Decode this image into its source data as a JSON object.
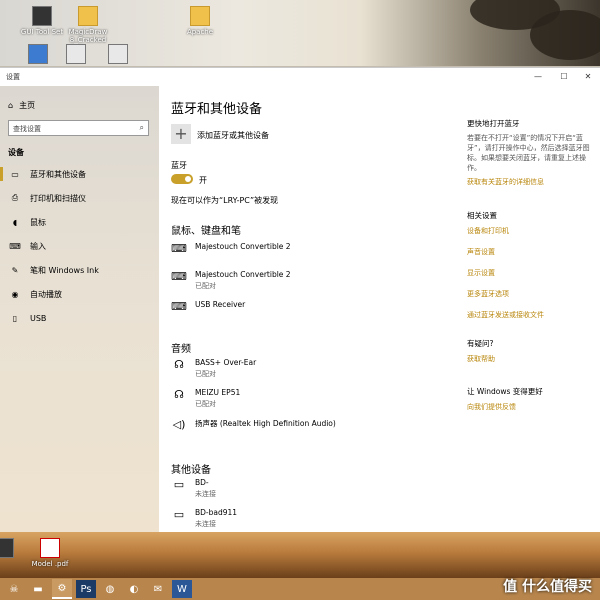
{
  "desktop": {
    "icons": [
      {
        "label": "GUI Tool Set",
        "icon": "app-icon"
      },
      {
        "label": "MagicDraw 8_Cracked",
        "icon": "folder-icon"
      },
      {
        "label": "Apache",
        "icon": "folder-icon"
      },
      {
        "label": "Model .pdf",
        "icon": "pdf-icon"
      }
    ]
  },
  "taskbar": {
    "apps": [
      "alienware-icon",
      "file-explorer-icon",
      "settings-icon",
      "photoshop-icon",
      "chrome-icon",
      "uplay-icon",
      "email-icon",
      "word-icon"
    ]
  },
  "watermark": "值 什么值得买",
  "window": {
    "title": "设置",
    "controls": {
      "minimize": "—",
      "maximize": "☐",
      "close": "✕"
    }
  },
  "sidebar": {
    "home": "主页",
    "search_placeholder": "查找设置",
    "section": "设备",
    "items": [
      {
        "label": "蓝牙和其他设备",
        "icon": "bluetooth-icon",
        "active": true
      },
      {
        "label": "打印机和扫描仪",
        "icon": "printer-icon",
        "active": false
      },
      {
        "label": "鼠标",
        "icon": "mouse-icon",
        "active": false
      },
      {
        "label": "输入",
        "icon": "keyboard-icon",
        "active": false
      },
      {
        "label": "笔和 Windows Ink",
        "icon": "pen-icon",
        "active": false
      },
      {
        "label": "自动播放",
        "icon": "autoplay-icon",
        "active": false
      },
      {
        "label": "USB",
        "icon": "usb-icon",
        "active": false
      }
    ]
  },
  "main": {
    "title": "蓝牙和其他设备",
    "add_device": "添加蓝牙或其他设备",
    "bluetooth_label": "蓝牙",
    "bluetooth_state": "开",
    "discoverable": "现在可以作为“LRY-PC”被发现",
    "sections": {
      "mouse_keyboard_pen": {
        "title": "鼠标、键盘和笔",
        "devices": [
          {
            "name": "Majestouch Convertible 2",
            "status": ""
          },
          {
            "name": "Majestouch Convertible 2",
            "status": "已配对"
          },
          {
            "name": "USB Receiver",
            "status": ""
          }
        ]
      },
      "audio": {
        "title": "音频",
        "devices": [
          {
            "name": "BASS+ Over-Ear",
            "status": "已配对"
          },
          {
            "name": "MEIZU EP51",
            "status": "已配对"
          },
          {
            "name": "扬声器 (Realtek High Definition Audio)",
            "status": ""
          }
        ]
      },
      "other": {
        "title": "其他设备",
        "devices": [
          {
            "name": "BD-",
            "status": "未连接"
          },
          {
            "name": "BD-bad911",
            "status": "未连接"
          }
        ]
      }
    }
  },
  "right": {
    "faster": {
      "title": "更快地打开蓝牙",
      "text": "若要在不打开“设置”的情况下开启“蓝牙”，请打开操作中心，然后选择蓝牙图标。如果想要关闭蓝牙，请重复上述操作。",
      "link": "获取有关蓝牙的详细信息"
    },
    "related": {
      "title": "相关设置",
      "links": [
        "设备和打印机",
        "声音设置",
        "显示设置",
        "更多蓝牙选项",
        "通过蓝牙发送或接收文件"
      ]
    },
    "question": {
      "title": "有疑问?",
      "link": "获取帮助"
    },
    "better": {
      "title": "让 Windows 变得更好",
      "link": "向我们提供反馈"
    }
  }
}
